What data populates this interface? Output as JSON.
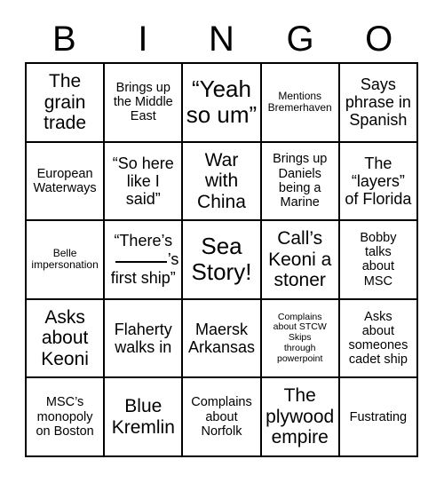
{
  "card": {
    "title": "BINGO",
    "header_letters": [
      "B",
      "I",
      "N",
      "G",
      "O"
    ],
    "columns": 5,
    "rows": 5,
    "border_color": "#000000",
    "background_color": "#ffffff",
    "text_color": "#000000"
  },
  "cells": [
    {
      "id": "b1",
      "text": "The\ngrain\ntrade",
      "size": "fs-lg"
    },
    {
      "id": "i1",
      "text": "Brings up\nthe Middle\nEast",
      "size": "fs-sm"
    },
    {
      "id": "n1",
      "text": "“Yeah\nso um”",
      "size": "fs-xl"
    },
    {
      "id": "g1",
      "text": "Mentions\nBremerhaven",
      "size": "fs-xs"
    },
    {
      "id": "o1",
      "text": "Says\nphrase in\nSpanish",
      "size": "fs-md"
    },
    {
      "id": "b2",
      "text": "European\nWaterways",
      "size": "fs-sm"
    },
    {
      "id": "i2",
      "text": "“So here\nlike I\nsaid”",
      "size": "fs-md"
    },
    {
      "id": "n2",
      "text": "War\nwith\nChina",
      "size": "fs-lg"
    },
    {
      "id": "g2",
      "text": "Brings up\nDaniels\nbeing a\nMarine",
      "size": "fs-sm"
    },
    {
      "id": "o2",
      "text": "The\n“layers”\nof Florida",
      "size": "fs-md"
    },
    {
      "id": "b3",
      "text": "Belle\nimpersonation",
      "size": "fs-xs"
    },
    {
      "id": "i3",
      "text": "“There’s\n______’s\nfirst ship”",
      "size": "fs-md",
      "variant": "blank"
    },
    {
      "id": "n3",
      "text": "Sea\nStory!",
      "size": "fs-xl"
    },
    {
      "id": "g3",
      "text": "Call’s\nKeoni a\nstoner",
      "size": "fs-lg"
    },
    {
      "id": "o3",
      "text": "Bobby\ntalks\nabout\nMSC",
      "size": "fs-sm"
    },
    {
      "id": "b4",
      "text": "Asks\nabout\nKeoni",
      "size": "fs-lg"
    },
    {
      "id": "i4",
      "text": "Flaherty\nwalks in",
      "size": "fs-md"
    },
    {
      "id": "n4",
      "text": "Maersk\nArkansas",
      "size": "fs-md"
    },
    {
      "id": "g4",
      "text": "Complains\nabout STCW\nSkips\nthrough\npowerpoint",
      "size": "fs-xxs"
    },
    {
      "id": "o4",
      "text": "Asks\nabout\nsomeones\ncadet ship",
      "size": "fs-sm"
    },
    {
      "id": "b5",
      "text": "MSC’s\nmonopoly\non Boston",
      "size": "fs-sm"
    },
    {
      "id": "i5",
      "text": "Blue\nKremlin",
      "size": "fs-lg"
    },
    {
      "id": "n5",
      "text": "Complains\nabout\nNorfolk",
      "size": "fs-sm"
    },
    {
      "id": "g5",
      "text": "The\nplywood\nempire",
      "size": "fs-lg"
    },
    {
      "id": "o5",
      "text": "Fustrating",
      "size": "fs-sm"
    }
  ],
  "blank_cell": {
    "line1": "“There’s",
    "line2_suffix": "’s",
    "line3": "first ship”"
  }
}
